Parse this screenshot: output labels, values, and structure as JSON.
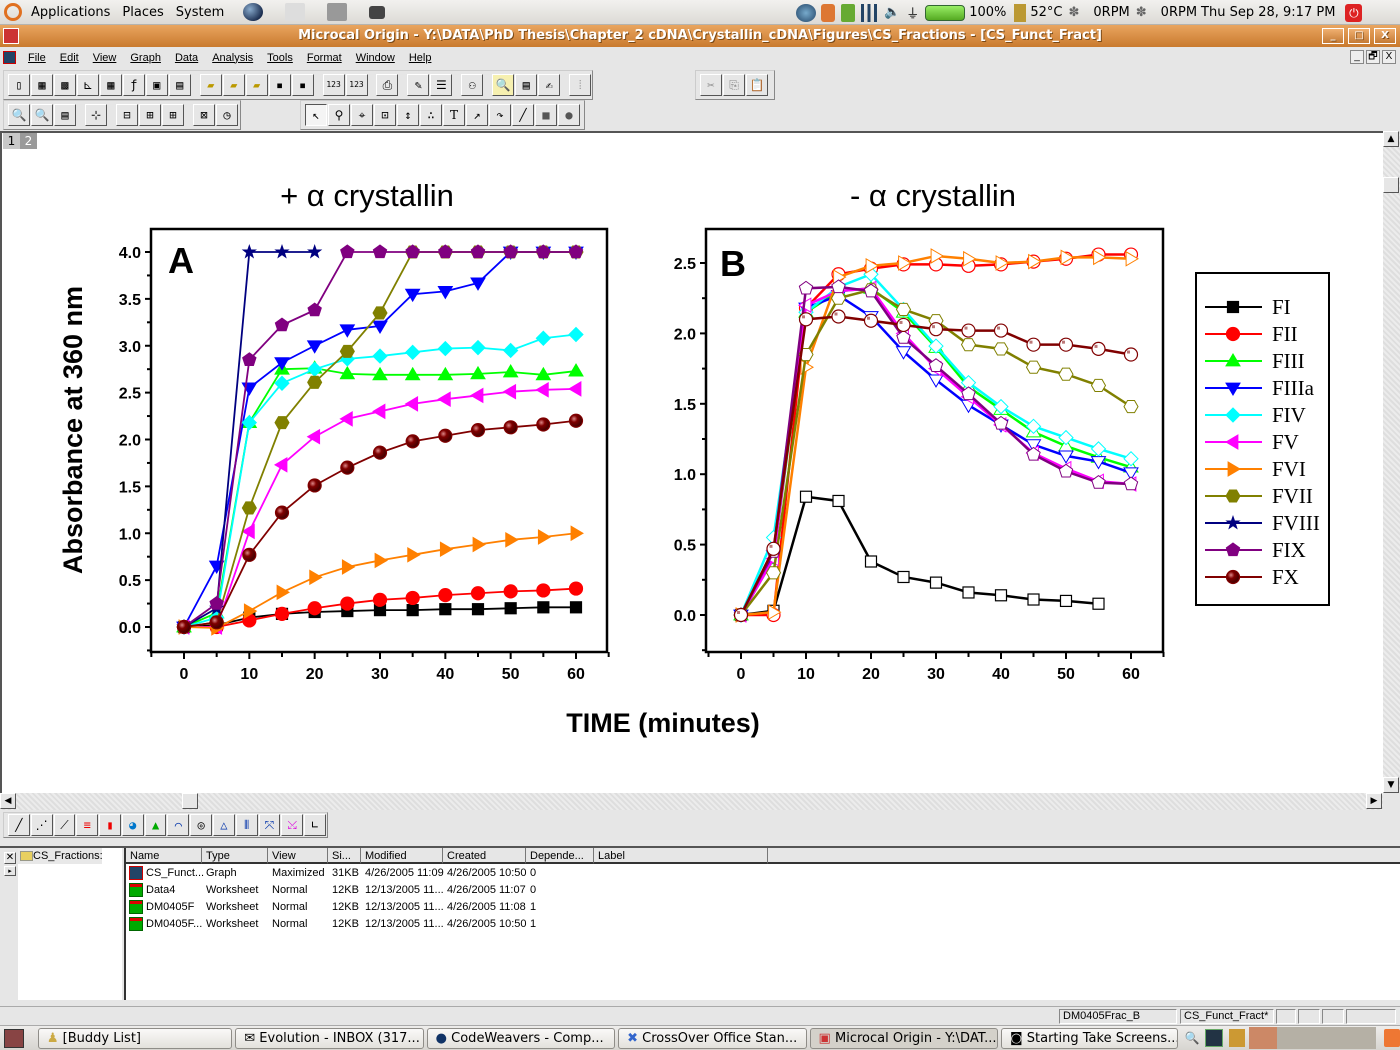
{
  "top_panel": {
    "menus": [
      "Applications",
      "Places",
      "System"
    ],
    "battery": "100%",
    "temperature": "52°C",
    "fan1": "0RPM",
    "fan2": "0RPM",
    "clock": "Thu Sep 28,  9:17 PM"
  },
  "window": {
    "title": "Microcal Origin - Y:\\DATA\\PhD Thesis\\Chapter_2 cDNA\\Crystallin_cDNA\\Figures\\CS_Fractions - [CS_Funct_Fract]",
    "minimize": "_",
    "maximize": "□",
    "close": "X"
  },
  "menubar": [
    "File",
    "Edit",
    "View",
    "Graph",
    "Data",
    "Analysis",
    "Tools",
    "Format",
    "Window",
    "Help"
  ],
  "mdi_controls": [
    "_",
    "🗗",
    "X"
  ],
  "page_tabs": [
    "1",
    "2"
  ],
  "graph": {
    "xlabel": "TIME (minutes)",
    "ylabel": "Absorbance at 360 nm"
  },
  "chart_data": [
    {
      "type": "line",
      "panel_label": "A",
      "title": "+ α crystallin",
      "xlabel": "TIME (minutes)",
      "ylabel": "Absorbance at 360 nm",
      "xlim": [
        -5,
        65
      ],
      "ylim": [
        -0.25,
        4.2
      ],
      "xticks": [
        0,
        10,
        20,
        30,
        40,
        50,
        60
      ],
      "yticks": [
        0.0,
        0.5,
        1.0,
        1.5,
        2.0,
        2.5,
        3.0,
        3.5,
        4.0
      ],
      "x": [
        0,
        5,
        10,
        15,
        20,
        25,
        30,
        35,
        40,
        45,
        50,
        55,
        60
      ],
      "marker_fill": "filled",
      "series": [
        {
          "name": "FI",
          "color": "#000000",
          "marker": "square",
          "values": [
            0,
            0.02,
            0.1,
            0.14,
            0.16,
            0.17,
            0.18,
            0.18,
            0.19,
            0.19,
            0.2,
            0.21,
            0.21
          ]
        },
        {
          "name": "FII",
          "color": "#ff0000",
          "marker": "circle",
          "values": [
            0,
            0,
            0.07,
            0.14,
            0.2,
            0.25,
            0.29,
            0.31,
            0.34,
            0.36,
            0.38,
            0.39,
            0.41
          ]
        },
        {
          "name": "FIII",
          "color": "#00ff00",
          "marker": "triangle-up",
          "values": [
            0,
            0.15,
            2.18,
            2.75,
            2.76,
            2.7,
            2.69,
            2.69,
            2.69,
            2.7,
            2.72,
            2.69,
            2.73
          ]
        },
        {
          "name": "FIIIa",
          "color": "#0000ff",
          "marker": "triangle-down",
          "values": [
            0,
            0.65,
            2.55,
            2.82,
            3.0,
            3.17,
            3.21,
            3.55,
            3.58,
            3.67,
            4.0,
            4.0,
            4.0
          ]
        },
        {
          "name": "FIV",
          "color": "#00ffff",
          "marker": "diamond",
          "values": [
            0,
            0.1,
            2.18,
            2.6,
            2.75,
            2.86,
            2.89,
            2.93,
            2.97,
            2.98,
            2.95,
            3.08,
            3.12
          ]
        },
        {
          "name": "FV",
          "color": "#ff00ff",
          "marker": "triangle-left",
          "values": [
            0,
            0,
            1.02,
            1.73,
            2.03,
            2.22,
            2.3,
            2.38,
            2.43,
            2.47,
            2.51,
            2.53,
            2.54
          ]
        },
        {
          "name": "FVI",
          "color": "#ff8000",
          "marker": "triangle-right",
          "values": [
            0,
            -0.01,
            0.17,
            0.37,
            0.53,
            0.64,
            0.71,
            0.77,
            0.83,
            0.88,
            0.93,
            0.96,
            1.0
          ]
        },
        {
          "name": "FVII",
          "color": "#808000",
          "marker": "hexagon",
          "values": [
            0,
            0.05,
            1.27,
            2.18,
            2.61,
            2.94,
            3.35,
            4.0,
            4.0,
            4.0,
            4.0,
            4.0,
            4.0
          ]
        },
        {
          "name": "FVIII",
          "color": "#000080",
          "marker": "star",
          "values": [
            0,
            0.2,
            4.0,
            4.0,
            4.0
          ]
        },
        {
          "name": "FIX",
          "color": "#800080",
          "marker": "pentagon",
          "values": [
            0,
            0.25,
            2.85,
            3.22,
            3.38,
            4.0,
            4.0,
            4.0,
            4.0,
            4.0,
            4.0,
            4.0,
            4.0
          ]
        },
        {
          "name": "FX",
          "color": "#800000",
          "marker": "sphere",
          "values": [
            0,
            0.05,
            0.77,
            1.22,
            1.51,
            1.7,
            1.86,
            1.98,
            2.04,
            2.1,
            2.13,
            2.16,
            2.2
          ]
        }
      ]
    },
    {
      "type": "line",
      "panel_label": "B",
      "title": "- α crystallin",
      "xlabel": "TIME (minutes)",
      "ylabel": "",
      "xlim": [
        -5,
        65
      ],
      "ylim": [
        -0.25,
        2.7
      ],
      "xticks": [
        0,
        10,
        20,
        30,
        40,
        50,
        60
      ],
      "yticks": [
        0.0,
        0.5,
        1.0,
        1.5,
        2.0,
        2.5
      ],
      "x": [
        0,
        5,
        10,
        15,
        20,
        25,
        30,
        35,
        40,
        45,
        50,
        55,
        60
      ],
      "marker_fill": "open",
      "series": [
        {
          "name": "FI",
          "color": "#000000",
          "marker": "square",
          "values": [
            0,
            0.03,
            0.84,
            0.81,
            0.38,
            0.27,
            0.23,
            0.16,
            0.14,
            0.11,
            0.1,
            0.08
          ]
        },
        {
          "name": "FII",
          "color": "#ff0000",
          "marker": "circle",
          "values": [
            0,
            0,
            2.18,
            2.42,
            2.46,
            2.49,
            2.49,
            2.48,
            2.49,
            2.51,
            2.53,
            2.56,
            2.56
          ]
        },
        {
          "name": "FIII",
          "color": "#00ff00",
          "marker": "triangle-up",
          "values": [
            0,
            0.4,
            2.15,
            2.3,
            2.32,
            2.15,
            1.9,
            1.62,
            1.46,
            1.3,
            1.2,
            1.12,
            1.05
          ]
        },
        {
          "name": "FIIIa",
          "color": "#0000ff",
          "marker": "triangle-down",
          "values": [
            0,
            0.42,
            2.18,
            2.27,
            2.12,
            1.87,
            1.67,
            1.49,
            1.35,
            1.21,
            1.13,
            1.09,
            1.01
          ]
        },
        {
          "name": "FIV",
          "color": "#00ffff",
          "marker": "diamond",
          "values": [
            0,
            0.55,
            2.15,
            2.33,
            2.42,
            2.17,
            1.91,
            1.65,
            1.48,
            1.34,
            1.26,
            1.18,
            1.11
          ]
        },
        {
          "name": "FV",
          "color": "#ff00ff",
          "marker": "triangle-left",
          "values": [
            0,
            0.4,
            2.2,
            2.3,
            2.32,
            2.0,
            1.75,
            1.55,
            1.35,
            1.15,
            1.04,
            0.95,
            0.93
          ]
        },
        {
          "name": "FVI",
          "color": "#ff8000",
          "marker": "triangle-right",
          "values": [
            0,
            0.02,
            1.76,
            2.4,
            2.48,
            2.5,
            2.55,
            2.53,
            2.5,
            2.51,
            2.54,
            2.54,
            2.53
          ]
        },
        {
          "name": "FVII",
          "color": "#808000",
          "marker": "hexagon",
          "values": [
            0,
            0.3,
            1.85,
            2.25,
            2.31,
            2.17,
            2.09,
            1.92,
            1.89,
            1.76,
            1.71,
            1.63,
            1.48
          ]
        },
        {
          "name": "FIX",
          "color": "#800080",
          "marker": "pentagon",
          "values": [
            0,
            0.45,
            2.32,
            2.33,
            2.3,
            1.97,
            1.77,
            1.57,
            1.36,
            1.14,
            1.02,
            0.94,
            0.93
          ]
        },
        {
          "name": "FX",
          "color": "#800000",
          "marker": "sphere",
          "values": [
            0,
            0.47,
            2.1,
            2.12,
            2.09,
            2.06,
            2.03,
            2.02,
            2.02,
            1.92,
            1.92,
            1.89,
            1.85
          ]
        }
      ]
    }
  ],
  "legend": {
    "placement": "right",
    "entries": [
      {
        "label": "FI",
        "color": "#000000",
        "marker": "square"
      },
      {
        "label": "FII",
        "color": "#ff0000",
        "marker": "circle"
      },
      {
        "label": "FIII",
        "color": "#00ff00",
        "marker": "triangle-up"
      },
      {
        "label": "FIIIa",
        "color": "#0000ff",
        "marker": "triangle-down"
      },
      {
        "label": "FIV",
        "color": "#00ffff",
        "marker": "diamond"
      },
      {
        "label": "FV",
        "color": "#ff00ff",
        "marker": "triangle-left"
      },
      {
        "label": "FVI",
        "color": "#ff8000",
        "marker": "triangle-right"
      },
      {
        "label": "FVII",
        "color": "#808000",
        "marker": "hexagon"
      },
      {
        "label": "FVIII",
        "color": "#000080",
        "marker": "star"
      },
      {
        "label": "FIX",
        "color": "#800080",
        "marker": "pentagon"
      },
      {
        "label": "FX",
        "color": "#800000",
        "marker": "sphere"
      }
    ]
  },
  "project_explorer": {
    "folder": "CS_Fractions:",
    "columns": [
      "Name",
      "Type",
      "View",
      "Si...",
      "Modified",
      "Created",
      "Depende...",
      "Label"
    ],
    "rows": [
      {
        "icon": "graph-icon",
        "name": "CS_Funct...",
        "type": "Graph",
        "view": "Maximized",
        "size": "31KB",
        "modified": "4/26/2005 11:09",
        "created": "4/26/2005 10:50",
        "dependents": "0",
        "label": ""
      },
      {
        "icon": "worksheet-icon",
        "name": "Data4",
        "type": "Worksheet",
        "view": "Normal",
        "size": "12KB",
        "modified": "12/13/2005 11...",
        "created": "4/26/2005 11:07",
        "dependents": "0",
        "label": ""
      },
      {
        "icon": "worksheet-icon",
        "name": "DM0405F",
        "type": "Worksheet",
        "view": "Normal",
        "size": "12KB",
        "modified": "12/13/2005 11...",
        "created": "4/26/2005 11:08",
        "dependents": "1",
        "label": ""
      },
      {
        "icon": "worksheet-icon",
        "name": "DM0405F...",
        "type": "Worksheet",
        "view": "Normal",
        "size": "12KB",
        "modified": "12/13/2005 11...",
        "created": "4/26/2005 10:50",
        "dependents": "1",
        "label": ""
      }
    ]
  },
  "statusbar": {
    "active_dataset": "DM0405Frac_B",
    "active_window": "CS_Funct_Fract*"
  },
  "taskbar": {
    "tasks": [
      {
        "label": "[Buddy List]",
        "icon": "buddy-icon"
      },
      {
        "label": "Evolution - INBOX (317...",
        "icon": "mail-icon"
      },
      {
        "label": "CodeWeavers - Comp...",
        "icon": "globe-icon"
      },
      {
        "label": "CrossOver Office Stan...",
        "icon": "crossover-icon"
      },
      {
        "label": "Microcal Origin - Y:\\DAT...",
        "icon": "origin-icon",
        "active": true
      },
      {
        "label": "Starting Take Screens...",
        "icon": "camera-icon"
      }
    ]
  }
}
